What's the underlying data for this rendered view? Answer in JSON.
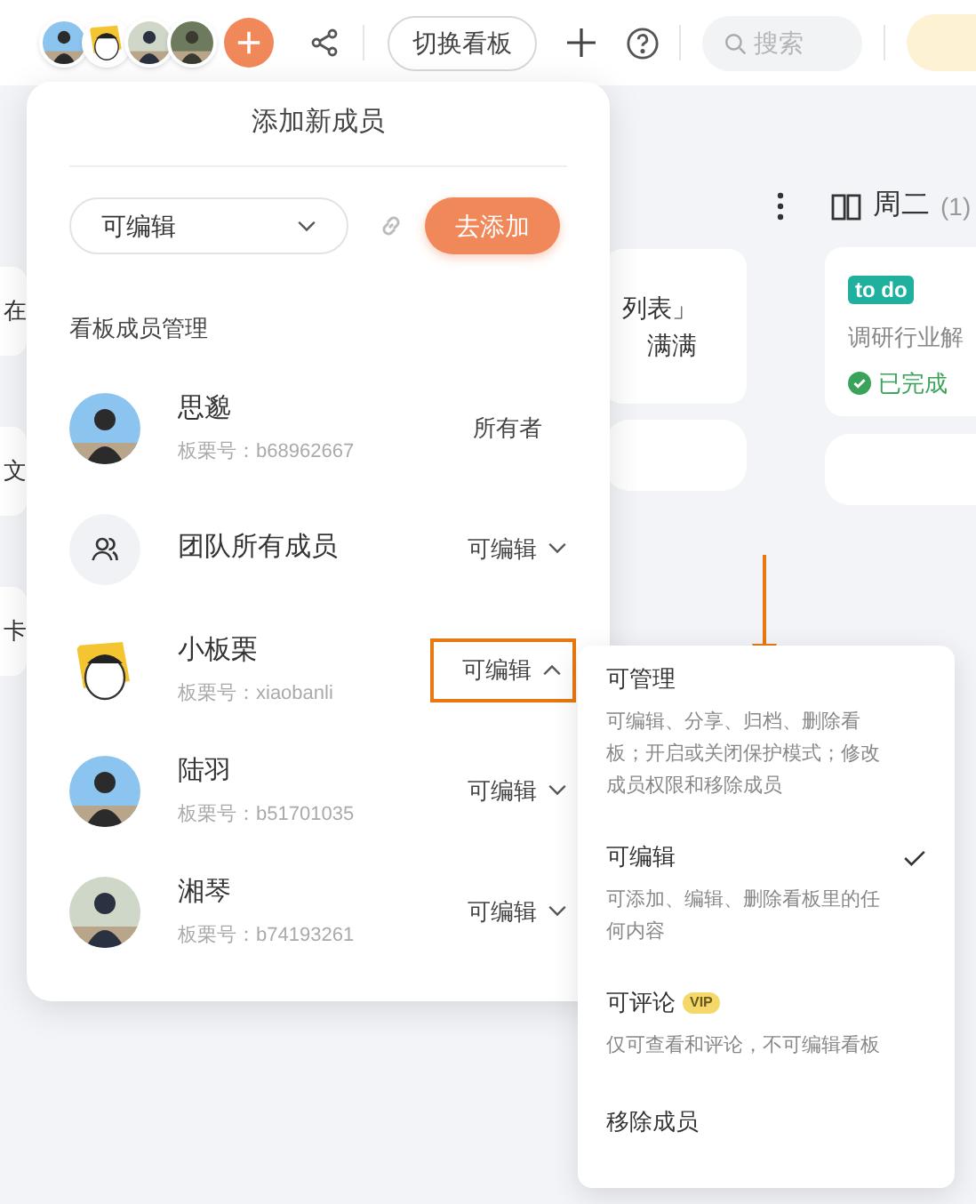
{
  "topbar": {
    "switch_button": "切换看板",
    "search": {
      "placeholder": "搜索"
    }
  },
  "board": {
    "left_fragments": [
      "在",
      "文",
      "卡"
    ],
    "middle_cards": [
      {
        "lines": [
          "列表」",
          "满满"
        ]
      }
    ],
    "column": {
      "title": "周二",
      "count": "(1)"
    },
    "card": {
      "tag": "to do",
      "text": "调研行业解",
      "status": "已完成"
    }
  },
  "popover": {
    "title": "添加新成员",
    "permission_select": {
      "value": "可编辑"
    },
    "add_button": "去添加",
    "section_label": "看板成员管理",
    "members": [
      {
        "kind": "person",
        "name": "思邈",
        "id": "板栗号：b68962667",
        "role": "所有者",
        "has_menu": false,
        "expanded": false
      },
      {
        "kind": "team",
        "name": "团队所有成员",
        "role": "可编辑",
        "has_menu": true,
        "expanded": false
      },
      {
        "kind": "sketch",
        "name": "小板栗",
        "id": "板栗号：xiaobanli",
        "role": "可编辑",
        "has_menu": true,
        "expanded": true
      },
      {
        "kind": "person",
        "name": "陆羽",
        "id": "板栗号：b51701035",
        "role": "可编辑",
        "has_menu": true,
        "expanded": false
      },
      {
        "kind": "person",
        "name": "湘琴",
        "id": "板栗号：b74193261",
        "role": "可编辑",
        "has_menu": true,
        "expanded": false
      }
    ]
  },
  "role_menu": {
    "options": [
      {
        "kind": "option",
        "label": "可管理",
        "description": "可编辑、分享、归档、删除看板；开启或关闭保护模式；修改成员权限和移除成员",
        "selected": false
      },
      {
        "kind": "option",
        "label": "可编辑",
        "description": "可添加、编辑、删除看板里的任何内容",
        "selected": true
      },
      {
        "kind": "option",
        "label": "可评论",
        "badge": "VIP",
        "description": "仅可查看和评论，不可编辑看板",
        "selected": false
      },
      {
        "kind": "action",
        "label": "移除成员",
        "selected": false
      }
    ]
  }
}
